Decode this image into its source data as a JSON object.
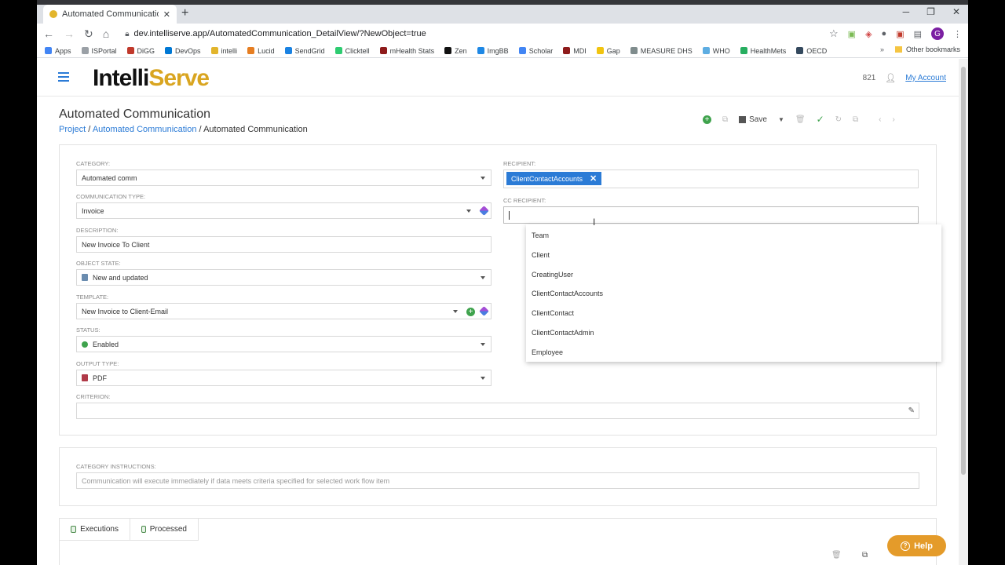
{
  "browser": {
    "tab_title": "Automated Communication - Int",
    "url": "dev.intelliserve.app/AutomatedCommunication_DetailView/?NewObject=true",
    "profile_initial": "G",
    "bookmarks": [
      {
        "label": "Apps",
        "color": "#4285f4"
      },
      {
        "label": "ISPortal",
        "color": "#9aa0a6"
      },
      {
        "label": "DiGG",
        "color": "#c0392b"
      },
      {
        "label": "DevOps",
        "color": "#0078d4"
      },
      {
        "label": "intelli",
        "color": "#e2b52c"
      },
      {
        "label": "Lucid",
        "color": "#e67e22"
      },
      {
        "label": "SendGrid",
        "color": "#1a82e2"
      },
      {
        "label": "Clicktell",
        "color": "#2ecc71"
      },
      {
        "label": "mHealth Stats",
        "color": "#8e1b1b"
      },
      {
        "label": "Zen",
        "color": "#111111"
      },
      {
        "label": "ImgBB",
        "color": "#1e88e5"
      },
      {
        "label": "Scholar",
        "color": "#4285f4"
      },
      {
        "label": "MDI",
        "color": "#8e1b1b"
      },
      {
        "label": "Gap",
        "color": "#f1c40f"
      },
      {
        "label": "MEASURE DHS",
        "color": "#7f8c8d"
      },
      {
        "label": "WHO",
        "color": "#5dade2"
      },
      {
        "label": "HealthMets",
        "color": "#27ae60"
      },
      {
        "label": "OECD",
        "color": "#34495e"
      }
    ],
    "other_bookmarks": "Other bookmarks"
  },
  "app": {
    "logo_a": "Intelli",
    "logo_b": "Serve",
    "user_id": "821",
    "account_link": "My Account"
  },
  "page": {
    "title": "Automated Communication",
    "breadcrumb": {
      "project": "Project",
      "sep1": " / ",
      "module": "Automated Communication",
      "sep2": " / ",
      "current": "Automated Communication"
    },
    "save_label": "Save"
  },
  "form": {
    "category": {
      "label": "CATEGORY:",
      "value": "Automated comm"
    },
    "communication_type": {
      "label": "COMMUNICATION TYPE:",
      "value": "Invoice"
    },
    "description": {
      "label": "DESCRIPTION:",
      "value": "New Invoice To Client"
    },
    "object_state": {
      "label": "OBJECT STATE:",
      "value": "New and updated"
    },
    "template": {
      "label": "TEMPLATE:",
      "value": "New Invoice to Client-Email"
    },
    "status": {
      "label": "STATUS:",
      "value": "Enabled",
      "color": "#3fa34d"
    },
    "output_type": {
      "label": "OUTPUT TYPE:",
      "value": "PDF"
    },
    "criterion": {
      "label": "CRITERION:",
      "value": ""
    },
    "recipient": {
      "label": "RECIPIENT:",
      "tag": "ClientContactAccounts"
    },
    "cc_recipient": {
      "label": "CC RECIPIENT:",
      "value": ""
    }
  },
  "cc_dropdown": [
    "Team",
    "Client",
    "CreatingUser",
    "ClientContactAccounts",
    "ClientContact",
    "ClientContactAdmin",
    "Employee"
  ],
  "instructions": {
    "label": "CATEGORY INSTRUCTIONS:",
    "text": "Communication will execute immediately if data meets criteria specified for selected work flow item"
  },
  "tabs": [
    "Executions",
    "Processed"
  ],
  "help": "Help",
  "colors": {
    "accent": "#2b7bd6",
    "brand_gold": "#d9a520",
    "help": "#e49b2a"
  }
}
